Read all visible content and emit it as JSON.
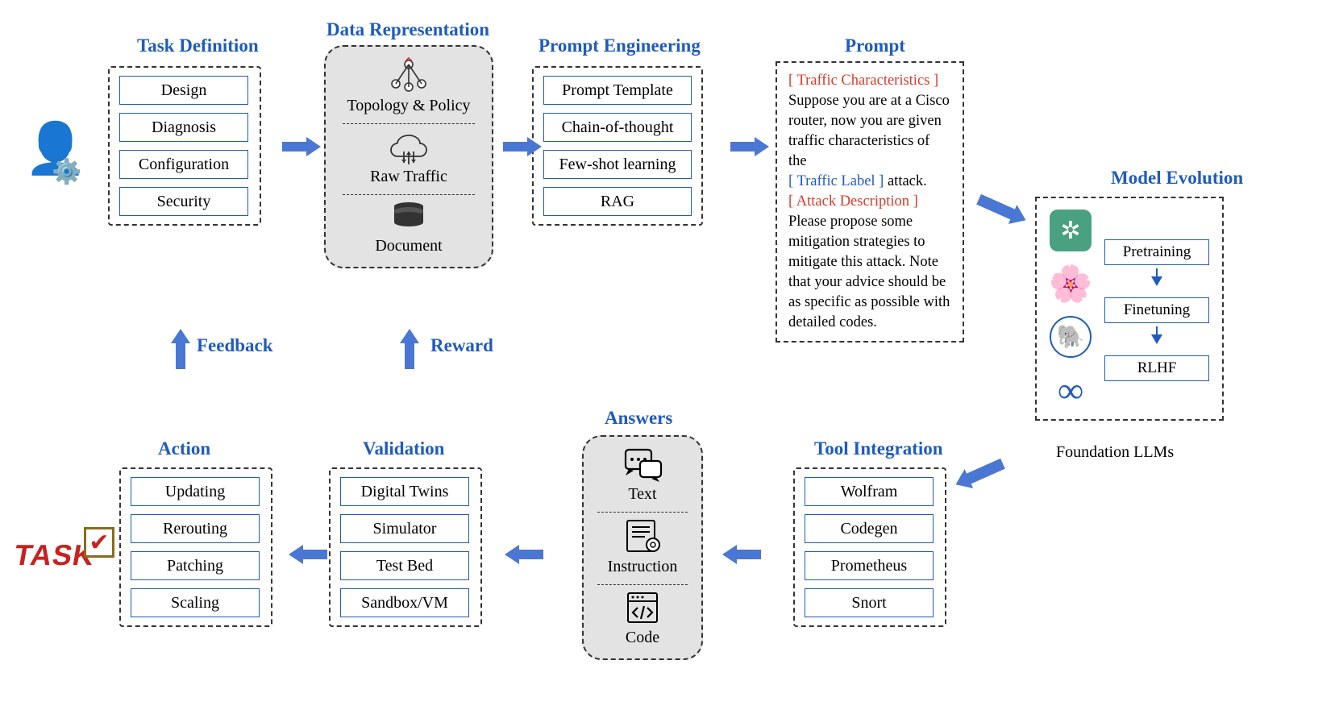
{
  "headings": {
    "task_def": "Task Definition",
    "data_rep": "Data Representation",
    "prompt_eng": "Prompt Engineering",
    "prompt": "Prompt",
    "model_evo": "Model Evolution",
    "tool_int": "Tool Integration",
    "answers": "Answers",
    "validation": "Validation",
    "action": "Action",
    "feedback": "Feedback",
    "reward": "Reward"
  },
  "task_def": [
    "Design",
    "Diagnosis",
    "Configuration",
    "Security"
  ],
  "data_rep": {
    "a": "Topology & Policy",
    "b": "Raw Traffic",
    "c": "Document"
  },
  "prompt_eng": [
    "Prompt Template",
    "Chain-of-thought",
    "Few-shot learning",
    "RAG"
  ],
  "prompt": {
    "p1": "[ Traffic Characteristics ]",
    "p2": "Suppose you are at a Cisco router, now you are given traffic characteristics of the",
    "p3": "[ Traffic Label ]",
    "p4": " attack.",
    "p5": "[ Attack Description ]",
    "p6": "Please propose some mitigation strategies to mitigate this attack. Note that your advice should be as specific as possible with detailed codes."
  },
  "model_evo": {
    "steps": [
      "Pretraining",
      "Finetuning",
      "RLHF"
    ],
    "caption": "Foundation LLMs"
  },
  "tool_int": [
    "Wolfram",
    "Codegen",
    "Prometheus",
    "Snort"
  ],
  "answers": {
    "a": "Text",
    "b": "Instruction",
    "c": "Code"
  },
  "validation": [
    "Digital Twins",
    "Simulator",
    "Test Bed",
    "Sandbox/VM"
  ],
  "action": [
    "Updating",
    "Rerouting",
    "Patching",
    "Scaling"
  ],
  "misc": {
    "task_word": "TASK"
  }
}
